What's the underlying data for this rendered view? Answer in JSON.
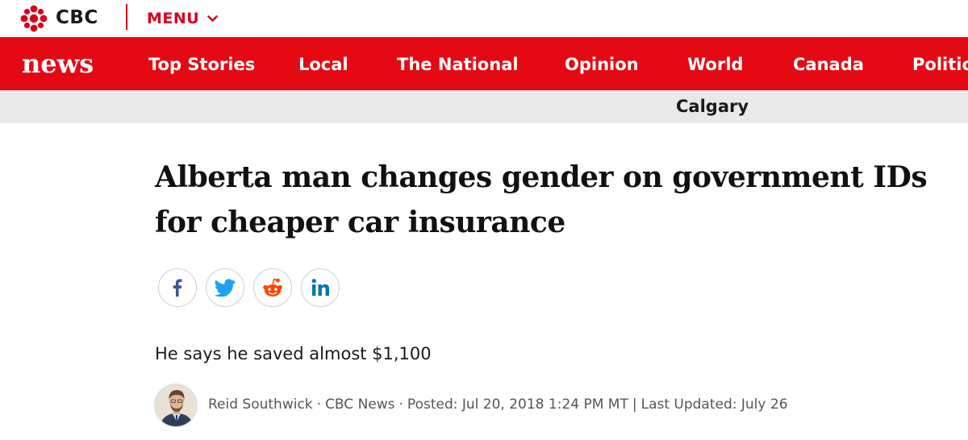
{
  "header": {
    "brand": "CBC",
    "menu_label": "MENU"
  },
  "nav": {
    "logo": "news",
    "items": [
      {
        "label": "Top Stories"
      },
      {
        "label": "Local"
      },
      {
        "label": "The National"
      },
      {
        "label": "Opinion"
      },
      {
        "label": "World"
      },
      {
        "label": "Canada"
      },
      {
        "label": "Politics"
      }
    ]
  },
  "section": {
    "name": "Calgary"
  },
  "article": {
    "headline": "Alberta man changes gender on government IDs for cheaper car insurance",
    "subhead": "He says he saved almost $1,100",
    "author": "Reid Southwick",
    "outlet": "CBC News",
    "posted": "Posted: Jul 20, 2018 1:24 PM MT",
    "updated": "Last Updated: July 26"
  },
  "share": {
    "icons": [
      "facebook-icon",
      "twitter-icon",
      "reddit-icon",
      "linkedin-icon"
    ]
  },
  "colors": {
    "brand_red": "#e50914",
    "subbar_gray": "#e9e9e9"
  }
}
